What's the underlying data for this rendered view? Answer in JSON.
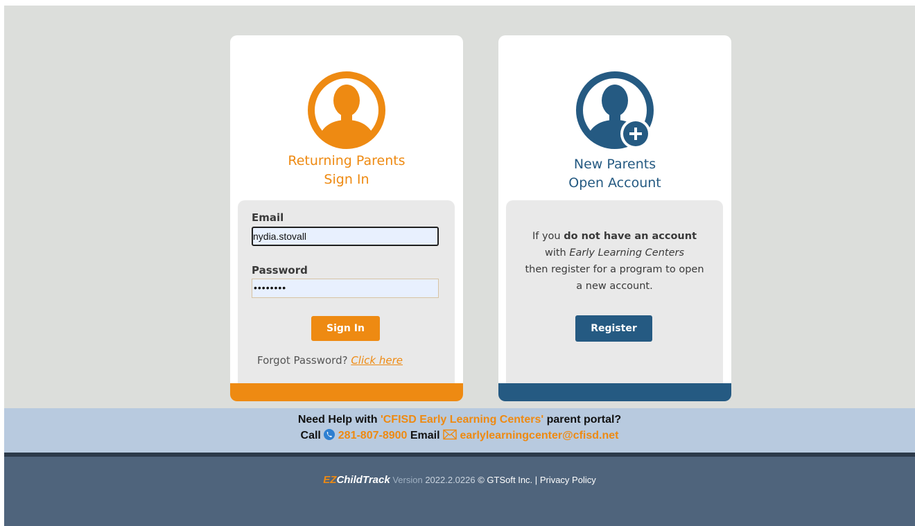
{
  "returning": {
    "title_line1": "Returning Parents",
    "title_line2": "Sign In",
    "email_label": "Email",
    "email_value": "nydia.stovall",
    "password_label": "Password",
    "password_value": "••••••••",
    "signin_label": "Sign In",
    "forgot_text": "Forgot Password?",
    "forgot_link": "Click here"
  },
  "new_parents": {
    "title_line1": "New Parents",
    "title_line2": "Open Account",
    "text_prefix": "If you ",
    "text_bold": "do not have an account",
    "text_with": "with ",
    "text_italic": "Early Learning Centers",
    "text_line3": "then register for a program to open",
    "text_line4": "a new account.",
    "register_label": "Register"
  },
  "help": {
    "prefix": "Need Help with ",
    "portal_name": "'CFISD Early Learning Centers'",
    "suffix": " parent portal?",
    "call_label": "Call",
    "phone": "281-807-8900",
    "email_label": "Email",
    "email": "earlylearningcenter@cfisd.net"
  },
  "footer": {
    "brand_ez": "EZ",
    "brand_rest": "ChildTrack",
    "version_label": "Version",
    "version_number": "2022.2.0226",
    "copyright": "© GTSoft Inc.",
    "separator": "|",
    "privacy": "Privacy Policy"
  },
  "colors": {
    "orange": "#ee8a12",
    "blue": "#255a82",
    "background": "#dcdedb",
    "help_bar": "#b8cadf",
    "footer": "#4f647c"
  },
  "icons": [
    "returning-parent-avatar-icon",
    "new-parent-avatar-icon",
    "plus-icon",
    "phone-icon",
    "mail-icon"
  ]
}
